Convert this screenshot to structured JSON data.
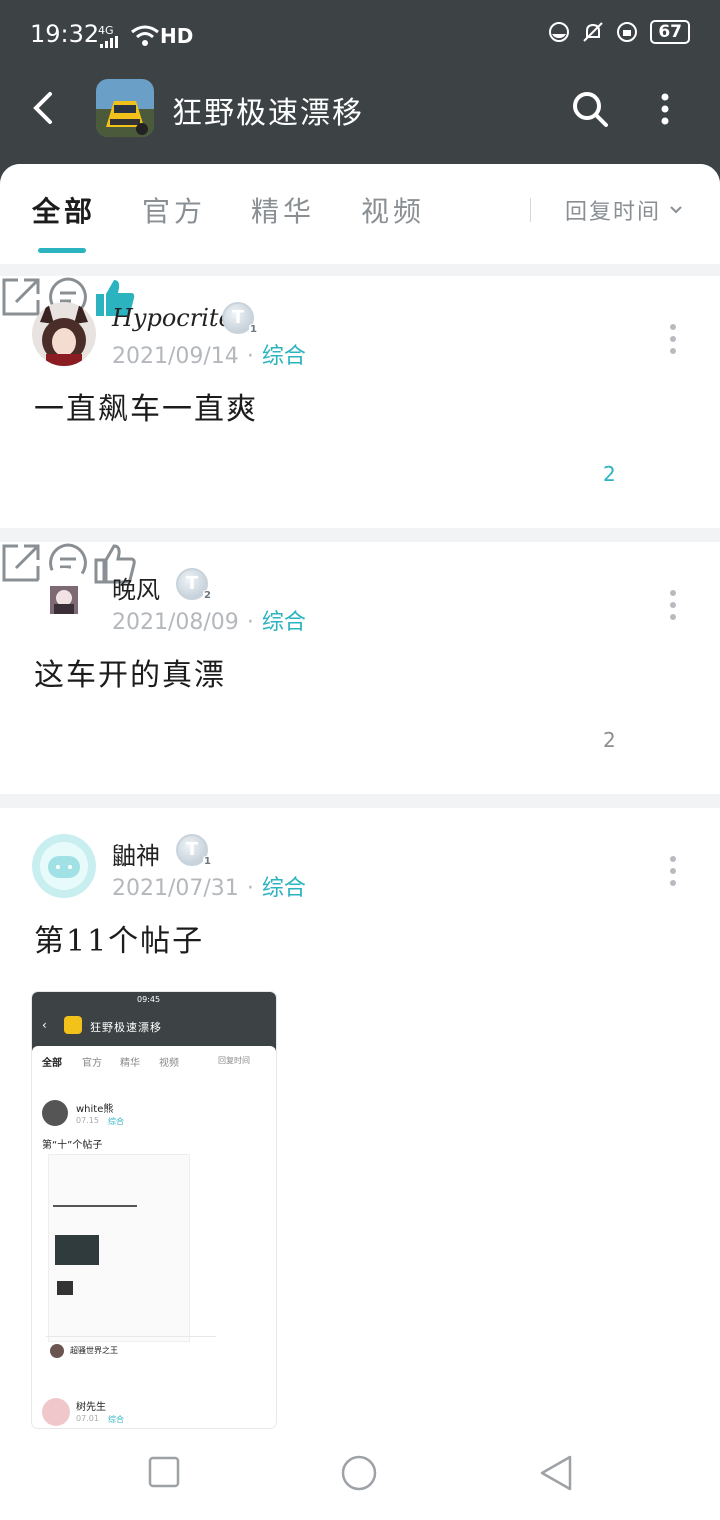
{
  "status": {
    "time": "19:32",
    "network": "4G",
    "battery": "67"
  },
  "header": {
    "title": "狂野极速漂移",
    "back_icon": "back-arrow-icon",
    "search_icon": "search-icon",
    "more_icon": "more-vertical-icon"
  },
  "tabs": [
    {
      "label": "全部",
      "active": true
    },
    {
      "label": "官方",
      "active": false
    },
    {
      "label": "精华",
      "active": false
    },
    {
      "label": "视频",
      "active": false
    }
  ],
  "sort": {
    "label": "回复时间"
  },
  "posts": [
    {
      "user": "Hypocrite",
      "level": "1",
      "date": "2021/09/14",
      "category": "综合",
      "text": "一直飙车一直爽",
      "likes": "2",
      "liked": true
    },
    {
      "user": "晚风",
      "level": "2",
      "date": "2021/08/09",
      "category": "综合",
      "text": "这车开的真漂",
      "likes": "2",
      "liked": false
    },
    {
      "user": "鼬神",
      "level": "1",
      "date": "2021/07/31",
      "category": "综合",
      "text": "第11个帖子",
      "has_image": true
    }
  ],
  "embedded_screenshot": {
    "title": "狂野极速漂移",
    "time": "09:45",
    "tabs": [
      "全部",
      "官方",
      "精华",
      "视频"
    ],
    "sort": "回复时间",
    "post_user": "white熊",
    "post_date": "07.15",
    "post_category": "综合",
    "post_text": "第“十”个帖子",
    "second_user": "超骚世界之王",
    "third_user": "树先生",
    "third_date": "07.01",
    "third_category": "综合"
  },
  "colors": {
    "accent": "#2bb3c0",
    "header_bg": "#3d4345"
  }
}
